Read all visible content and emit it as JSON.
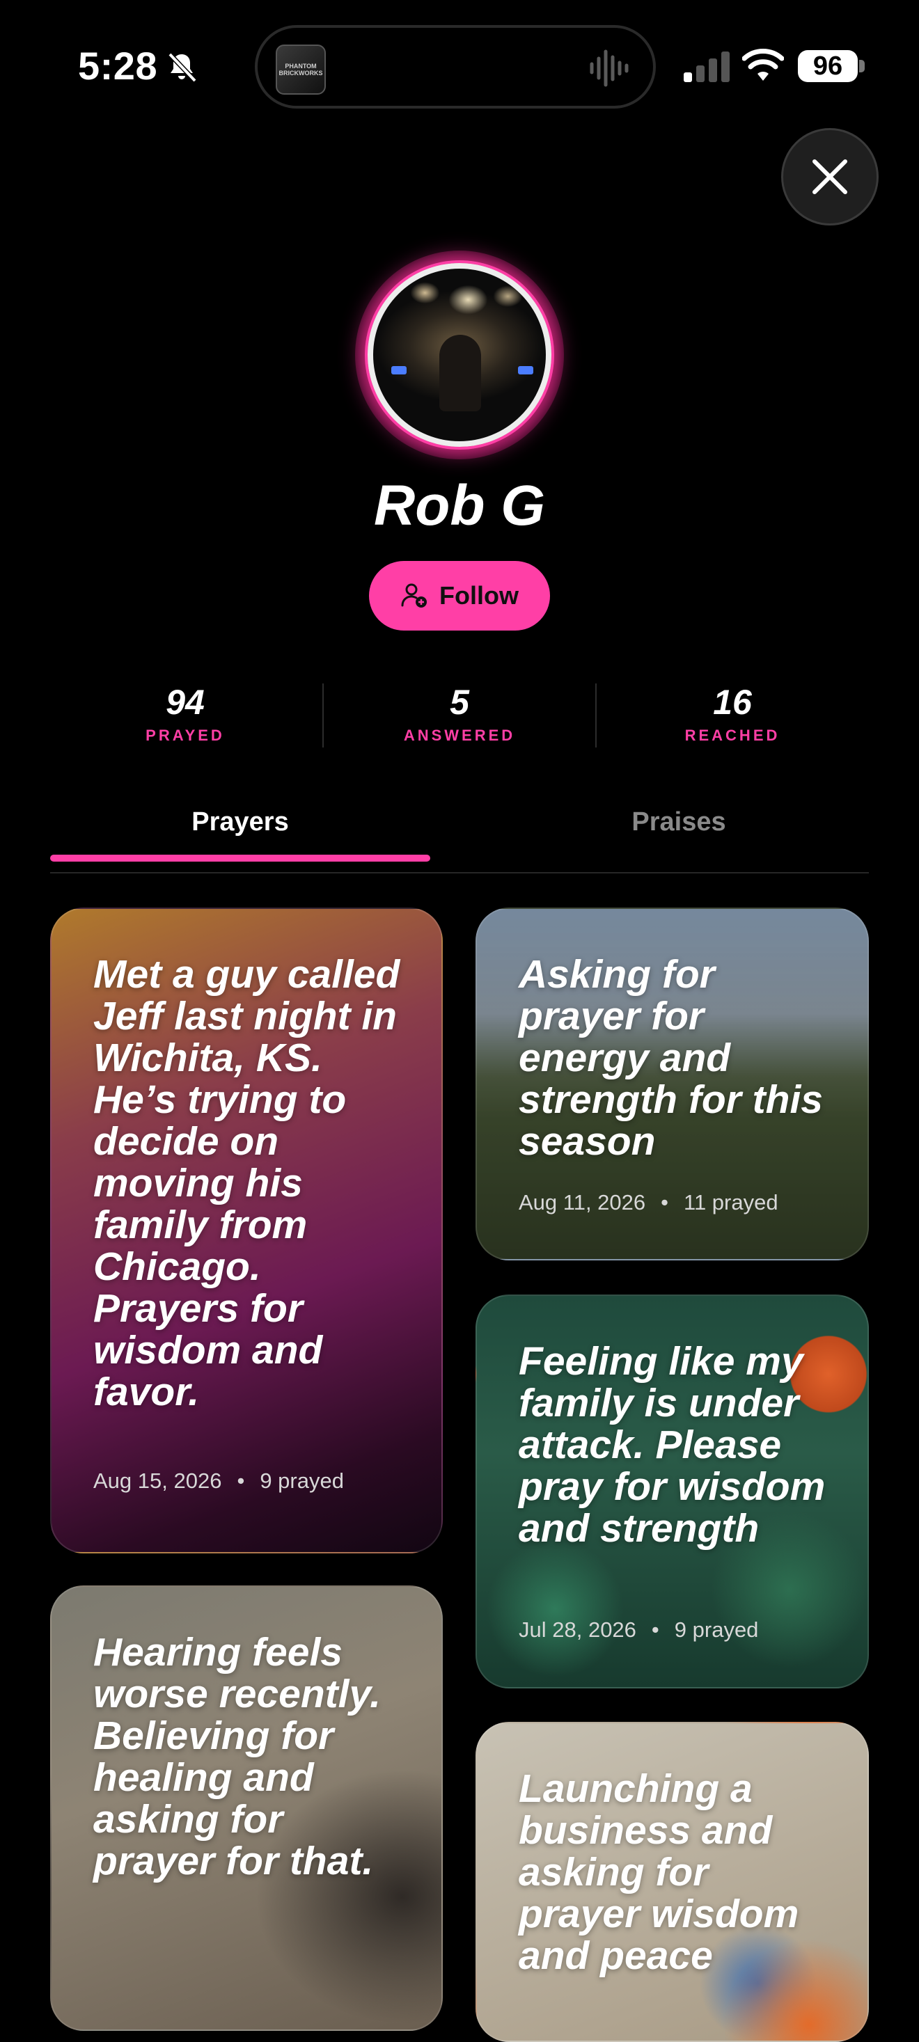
{
  "status_bar": {
    "time": "5:28",
    "battery": "96",
    "island_thumb_label": "PHANTOM BRICKWORKS"
  },
  "profile": {
    "name": "Rob G",
    "follow_label": "Follow"
  },
  "stats": [
    {
      "value": "94",
      "label": "PRAYED"
    },
    {
      "value": "5",
      "label": "ANSWERED"
    },
    {
      "value": "16",
      "label": "REACHED"
    }
  ],
  "tabs": [
    {
      "label": "Prayers",
      "active": true
    },
    {
      "label": "Praises",
      "active": false
    }
  ],
  "cards": [
    {
      "text": "Met a guy called Jeff last night in Wichita, KS. He’s trying to decide on moving his family from Chicago. Prayers for wisdom and favor.",
      "date": "Aug 15, 2026",
      "prayed": "9 prayed"
    },
    {
      "text": "Asking for prayer for energy and strength for this season",
      "date": "Aug 11, 2026",
      "prayed": "11 prayed"
    },
    {
      "text": "Feeling like my family is under attack. Please pray for wisdom and strength",
      "date": "Jul 28, 2026",
      "prayed": "9 prayed"
    },
    {
      "text": "Hearing feels worse recently. Believing for healing and asking for prayer for that.",
      "date": "",
      "prayed": ""
    },
    {
      "text": "Launching a business and asking for prayer wisdom and peace",
      "date": "",
      "prayed": ""
    }
  ],
  "colors": {
    "accent": "#ff3fa6",
    "background": "#000000",
    "inactive_tab": "#8a8a8a"
  }
}
